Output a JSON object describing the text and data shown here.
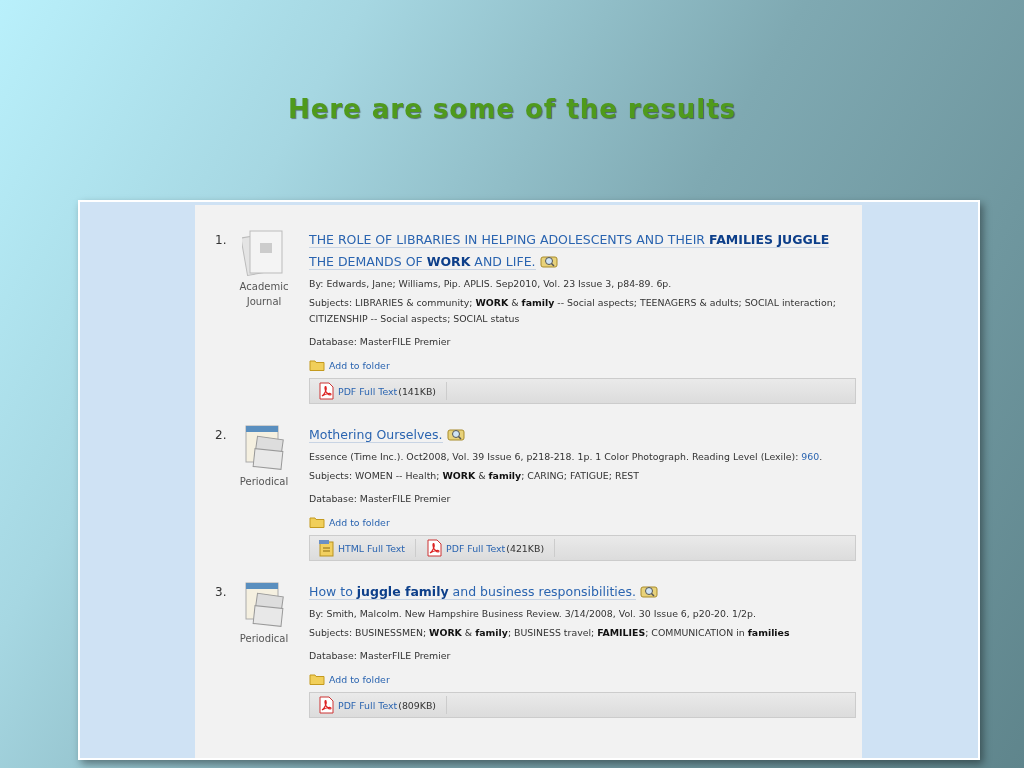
{
  "slide_title": "Here are some of the results",
  "results": [
    {
      "number": "1.",
      "kind": "journal",
      "type_label": "Academic Journal",
      "title": "THE ROLE OF LIBRARIES IN HELPING ADOLESCENTS AND THEIR **FAMILIES JUGGLE** THE DEMANDS OF **WORK** AND LIFE.",
      "source": "By: Edwards, Jane; Williams, Pip. APLIS. Sep2010, Vol. 23 Issue 3, p84-89. 6p.",
      "subjects": "Subjects: LIBRARIES & community; **WORK** & **family** -- Social aspects; TEENAGERS & adults; SOCIAL interaction; CITIZENSHIP -- Social aspects; SOCIAL status",
      "database": "Database: MasterFILE Premier",
      "add_to_folder": "Add to folder",
      "links": [
        {
          "kind": "pdf",
          "label": "PDF Full Text",
          "size": "(141KB)"
        }
      ]
    },
    {
      "number": "2.",
      "kind": "periodical",
      "type_label": "Periodical",
      "title": "Mothering Ourselves.",
      "source": "Essence (Time Inc.). Oct2008, Vol. 39 Issue 6, p218-218. 1p. 1 Color Photograph. Reading Level (Lexile):",
      "lexile": "960",
      "lexile_end": ".",
      "subjects": "Subjects: WOMEN -- Health; **WORK** & **family**; CARING; FATIGUE; REST",
      "database": "Database: MasterFILE Premier",
      "add_to_folder": "Add to folder",
      "links": [
        {
          "kind": "html",
          "label": "HTML Full Text"
        },
        {
          "kind": "pdf",
          "label": "PDF Full Text",
          "size": "(421KB)"
        }
      ]
    },
    {
      "number": "3.",
      "kind": "periodical",
      "type_label": "Periodical",
      "title": "How to **juggle family** and business responsibilities.",
      "source": "By: Smith, Malcolm. New Hampshire Business Review. 3/14/2008, Vol. 30 Issue 6, p20-20. 1/2p.",
      "subjects": "Subjects: BUSINESSMEN; **WORK** & **family**; BUSINESS travel; **FAMILIES**; COMMUNICATION in **families**",
      "database": "Database: MasterFILE Premier",
      "add_to_folder": "Add to folder",
      "links": [
        {
          "kind": "pdf",
          "label": "PDF Full Text",
          "size": "(809KB)"
        }
      ]
    }
  ]
}
